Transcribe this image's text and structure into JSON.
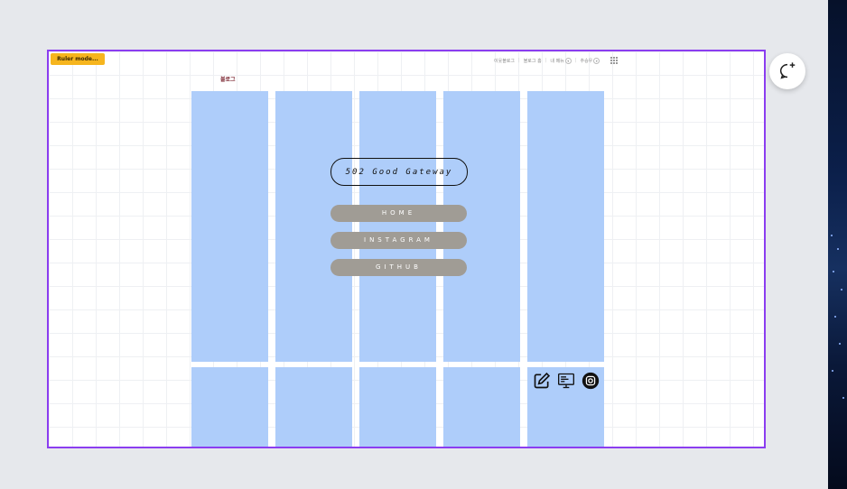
{
  "toolbar": {
    "ruler_label": "Ruler mode..."
  },
  "blog_link": "블로그",
  "topnav": {
    "items": [
      "이웃블로그",
      "블로그 홈",
      "내 메뉴",
      "추승우"
    ]
  },
  "main": {
    "title": "502 Good Gateway",
    "nav": [
      {
        "label": "HOME"
      },
      {
        "label": "INSTAGRAM"
      },
      {
        "label": "GITHUB"
      }
    ]
  },
  "icons": [
    "edit-icon",
    "monitor-icon",
    "camera-icon"
  ],
  "chat_button_icon": "add-comment-icon",
  "colors": {
    "accent_border": "#8b3df0",
    "column_fill": "#aecdfa",
    "nav_pill": "#a09c95",
    "ruler_button": "#f6b51e",
    "page_bg": "#e6e8ec"
  }
}
